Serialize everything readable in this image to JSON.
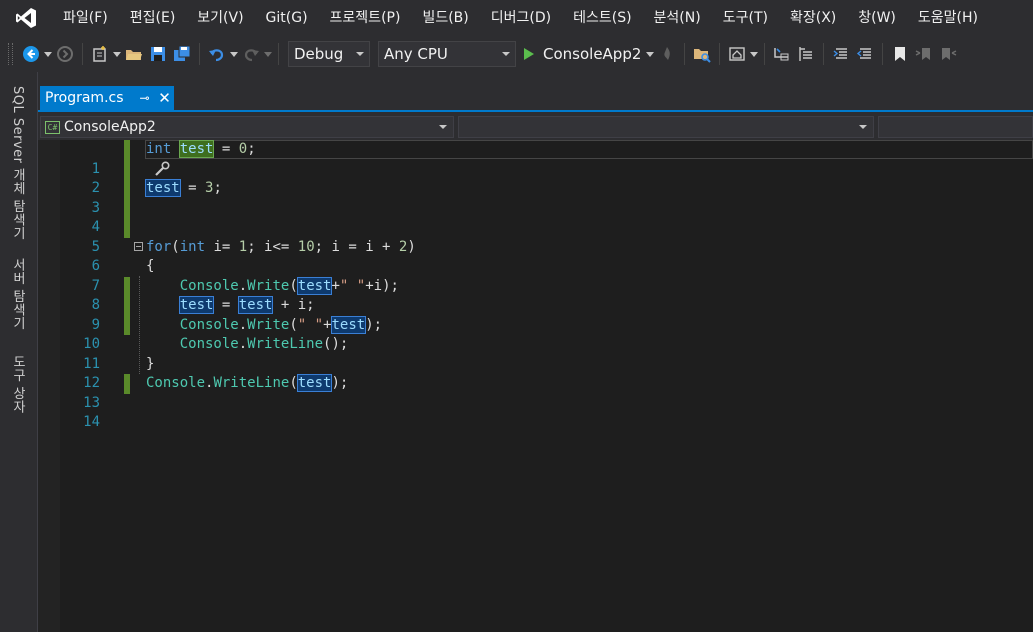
{
  "menu": [
    "파일(F)",
    "편집(E)",
    "보기(V)",
    "Git(G)",
    "프로젝트(P)",
    "빌드(B)",
    "디버그(D)",
    "테스트(S)",
    "분석(N)",
    "도구(T)",
    "확장(X)",
    "창(W)",
    "도움말(H)"
  ],
  "toolbar": {
    "config": "Debug",
    "platform": "Any CPU",
    "run_label": "ConsoleApp2"
  },
  "side_tabs": [
    "SQL Server 개체 탐색기",
    "서버 탐색기",
    "도구 상자"
  ],
  "tab": {
    "title": "Program.cs",
    "pin": "⊸",
    "close": "✕"
  },
  "navbar": {
    "project": "ConsoleApp2"
  },
  "editor": {
    "line_numbers": [
      "1",
      "2",
      "3",
      "4",
      "5",
      "6",
      "7",
      "8",
      "9",
      "10",
      "11",
      "12",
      "13",
      "14"
    ]
  },
  "colors": {
    "accent": "#007acc",
    "change_marker": "#5a8a2a",
    "line_number": "#2b91af"
  }
}
